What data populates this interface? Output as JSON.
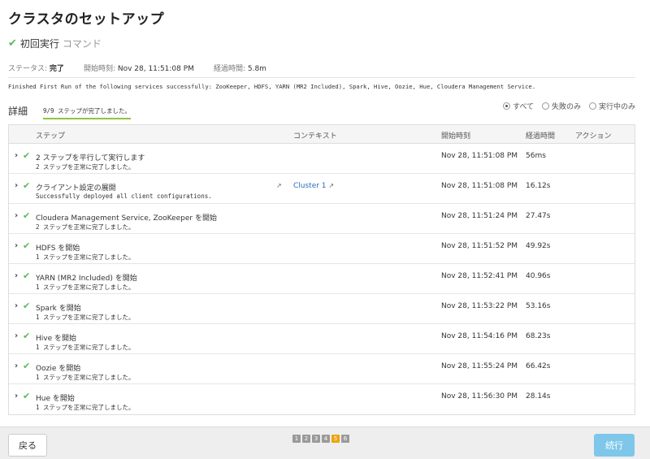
{
  "title": "クラスタのセットアップ",
  "command": {
    "name": "初回実行",
    "type": "コマンド"
  },
  "status": {
    "status_label": "ステータス:",
    "status_value": "完了",
    "start_label": "開始時刻:",
    "start_value": "Nov 28, 11:51:08 PM",
    "elapsed_label": "経過時間:",
    "elapsed_value": "5.8m"
  },
  "message": "Finished First Run of the following services successfully: ZooKeeper, HDFS, YARN (MR2 Included), Spark, Hive, Oozie, Hue, Cloudera Management Service.",
  "details": {
    "label": "詳細",
    "progress": "9/9 ステップが完了しました。"
  },
  "filters": [
    {
      "label": "すべて",
      "selected": true
    },
    {
      "label": "失敗のみ",
      "selected": false
    },
    {
      "label": "実行中のみ",
      "selected": false
    }
  ],
  "table": {
    "headers": {
      "step": "ステップ",
      "context": "コンテキスト",
      "start": "開始時刻",
      "elapsed": "経過時間",
      "action": "アクション"
    },
    "rows": [
      {
        "title": "2 ステップを平行して実行します",
        "sub": "2 ステップを正常に完了しました。",
        "context": "",
        "start": "Nov 28, 11:51:08 PM",
        "elapsed": "56ms"
      },
      {
        "title": "クライアント設定の展開",
        "sub": "Successfully deployed all client configurations.",
        "context": "Cluster 1",
        "start": "Nov 28, 11:51:08 PM",
        "elapsed": "16.12s"
      },
      {
        "title": "Cloudera Management Service, ZooKeeper を開始",
        "sub": "2 ステップを正常に完了しました。",
        "context": "",
        "start": "Nov 28, 11:51:24 PM",
        "elapsed": "27.47s"
      },
      {
        "title": "HDFS を開始",
        "sub": "1 ステップを正常に完了しました。",
        "context": "",
        "start": "Nov 28, 11:51:52 PM",
        "elapsed": "49.92s"
      },
      {
        "title": "YARN (MR2 Included) を開始",
        "sub": "1 ステップを正常に完了しました。",
        "context": "",
        "start": "Nov 28, 11:52:41 PM",
        "elapsed": "40.96s"
      },
      {
        "title": "Spark を開始",
        "sub": "1 ステップを正常に完了しました。",
        "context": "",
        "start": "Nov 28, 11:53:22 PM",
        "elapsed": "53.16s"
      },
      {
        "title": "Hive を開始",
        "sub": "1 ステップを正常に完了しました。",
        "context": "",
        "start": "Nov 28, 11:54:16 PM",
        "elapsed": "68.23s"
      },
      {
        "title": "Oozie を開始",
        "sub": "1 ステップを正常に完了しました。",
        "context": "",
        "start": "Nov 28, 11:55:24 PM",
        "elapsed": "66.42s"
      },
      {
        "title": "Hue を開始",
        "sub": "1 ステップを正常に完了しました。",
        "context": "",
        "start": "Nov 28, 11:56:30 PM",
        "elapsed": "28.14s"
      }
    ]
  },
  "footer": {
    "back_label": "戻る",
    "next_label": "続行",
    "pages": [
      "1",
      "2",
      "3",
      "4",
      "5",
      "6"
    ],
    "active_page": "5"
  },
  "colors": {
    "success": "#5cb85c",
    "link": "#2a6ebb",
    "active_page": "#f0a30a",
    "primary_button": "#7ec7ea"
  }
}
